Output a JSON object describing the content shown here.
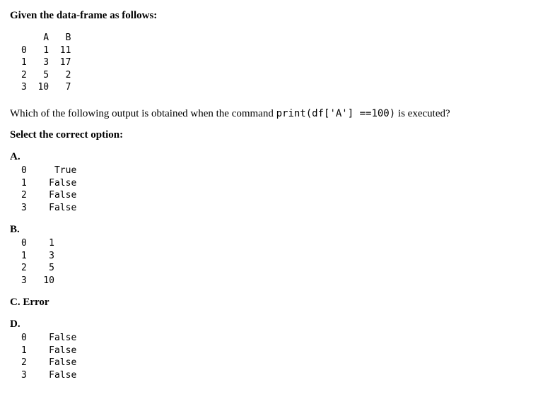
{
  "intro": "Given the data-frame as follows:",
  "dataframe_text": "    A   B\n0   1  11\n1   3  17\n2   5   2\n3  10   7",
  "question_pre": "Which of the following output is obtained when the command ",
  "question_code": "print(df['A'] ==100)",
  "question_post": " is executed?",
  "select_label": "Select the correct option:",
  "options": {
    "A": {
      "label": "A.",
      "text": "0     True\n1    False\n2    False\n3    False"
    },
    "B": {
      "label": "B.",
      "text": "0    1\n1    3\n2    5\n3   10"
    },
    "C": {
      "label": "C.",
      "text": "Error"
    },
    "D": {
      "label": "D.",
      "text": "0    False\n1    False\n2    False\n3    False"
    }
  },
  "chart_data": {
    "type": "table",
    "columns": [
      "A",
      "B"
    ],
    "index": [
      0,
      1,
      2,
      3
    ],
    "rows": [
      {
        "A": 1,
        "B": 11
      },
      {
        "A": 3,
        "B": 17
      },
      {
        "A": 5,
        "B": 2
      },
      {
        "A": 10,
        "B": 7
      }
    ]
  }
}
